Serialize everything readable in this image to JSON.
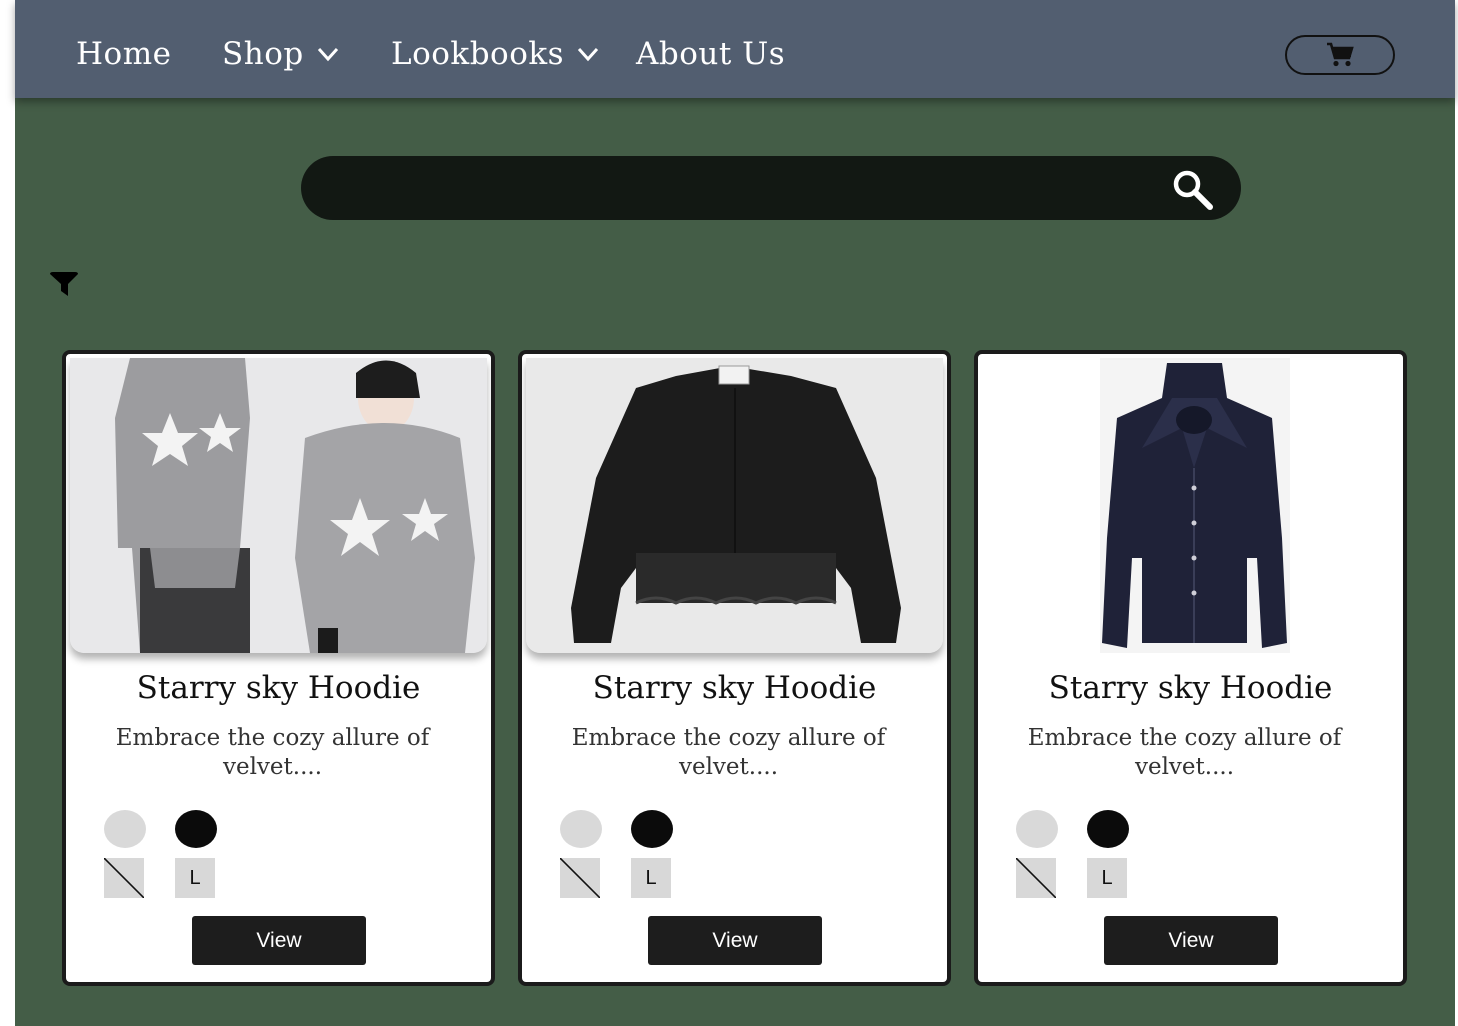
{
  "nav": {
    "items": [
      {
        "label": "Home",
        "has_dropdown": false
      },
      {
        "label": "Shop",
        "has_dropdown": true
      },
      {
        "label": "Lookbooks",
        "has_dropdown": true
      },
      {
        "label": "About Us",
        "has_dropdown": false
      }
    ],
    "cart_icon": "cart-icon"
  },
  "search": {
    "value": "",
    "placeholder": "",
    "icon": "search-icon"
  },
  "filter": {
    "icon": "filter-icon"
  },
  "colors": {
    "nav_bg": "#525e70",
    "page_bg": "#445d47",
    "search_bg": "#121813",
    "button_bg": "#1d1d1d"
  },
  "products": [
    {
      "image": "hoodie-photo",
      "title": "Starry sky Hoodie",
      "description": "Embrace the cozy allure of velvet....",
      "swatches": [
        "#d9d9d9",
        "#0b0b0b"
      ],
      "sizes": [
        "",
        "L"
      ],
      "view_label": "View"
    },
    {
      "image": "black-blouse-photo",
      "title": "Starry sky Hoodie",
      "description": "Embrace the cozy allure of velvet....",
      "swatches": [
        "#d9d9d9",
        "#0b0b0b"
      ],
      "sizes": [
        "",
        "L"
      ],
      "view_label": "View"
    },
    {
      "image": "navy-blouse-photo",
      "title": "Starry sky Hoodie",
      "description": "Embrace the cozy allure of velvet....",
      "swatches": [
        "#d9d9d9",
        "#0b0b0b"
      ],
      "sizes": [
        "",
        "L"
      ],
      "view_label": "View"
    }
  ]
}
